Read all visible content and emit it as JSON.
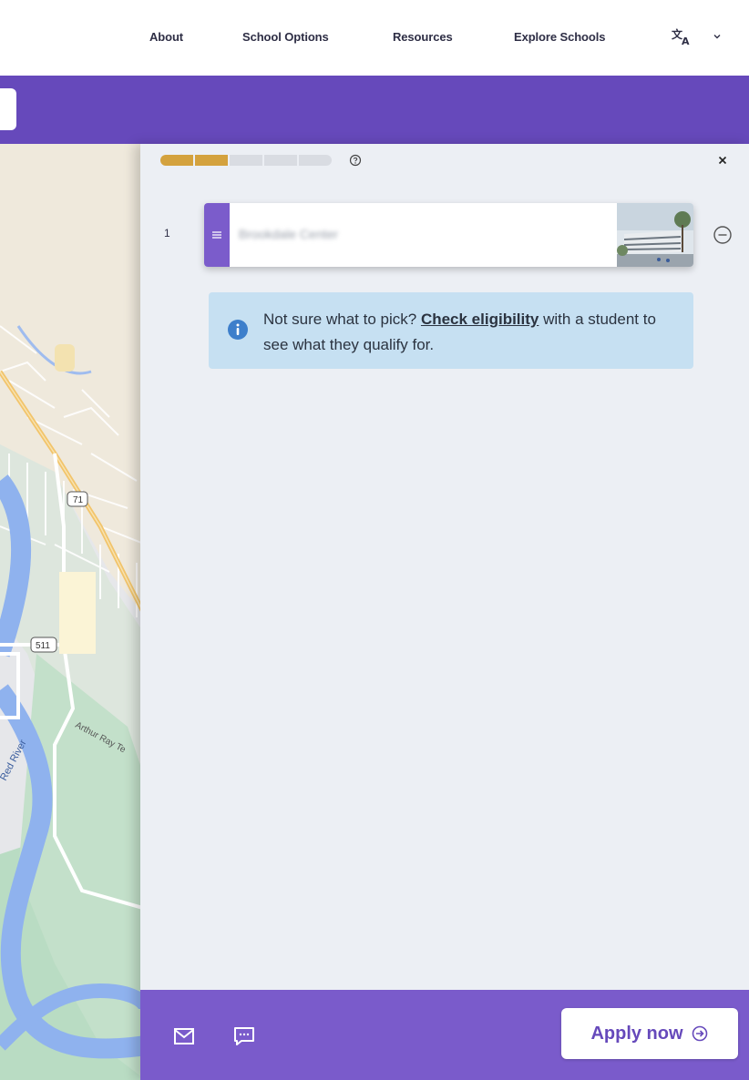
{
  "nav": {
    "links": [
      {
        "label": "About"
      },
      {
        "label": "School Options"
      },
      {
        "label": "Resources"
      },
      {
        "label": "Explore Schools"
      }
    ],
    "language_icon": "translate-icon",
    "language_caret_icon": "chevron-down-icon"
  },
  "map": {
    "road_labels": [
      "71",
      "511"
    ],
    "place_labels": [
      "Red River",
      "Arthur Ray Te"
    ]
  },
  "panel": {
    "progress": {
      "filled": 2,
      "total": 5
    },
    "help_icon": "question-circle-icon",
    "close_icon": "close-icon",
    "choices": [
      {
        "rank": "1",
        "name": "Brookdale Center"
      }
    ],
    "remove_icon": "minus-circle-icon",
    "info": {
      "prefix": "Not sure what to pick?",
      "link": "Check eligibility",
      "suffix": "with a student to see what they qualify for.",
      "icon": "info-icon"
    },
    "footer": {
      "email_icon": "mail-icon",
      "chat_icon": "chat-icon",
      "apply_label": "Apply now",
      "apply_icon": "arrow-right-circle-icon"
    }
  },
  "colors": {
    "brand_purple": "#6649bb",
    "footer_purple": "#7a5bcb",
    "progress_gold": "#d4a23e",
    "info_blue": "#c6e0f2"
  }
}
